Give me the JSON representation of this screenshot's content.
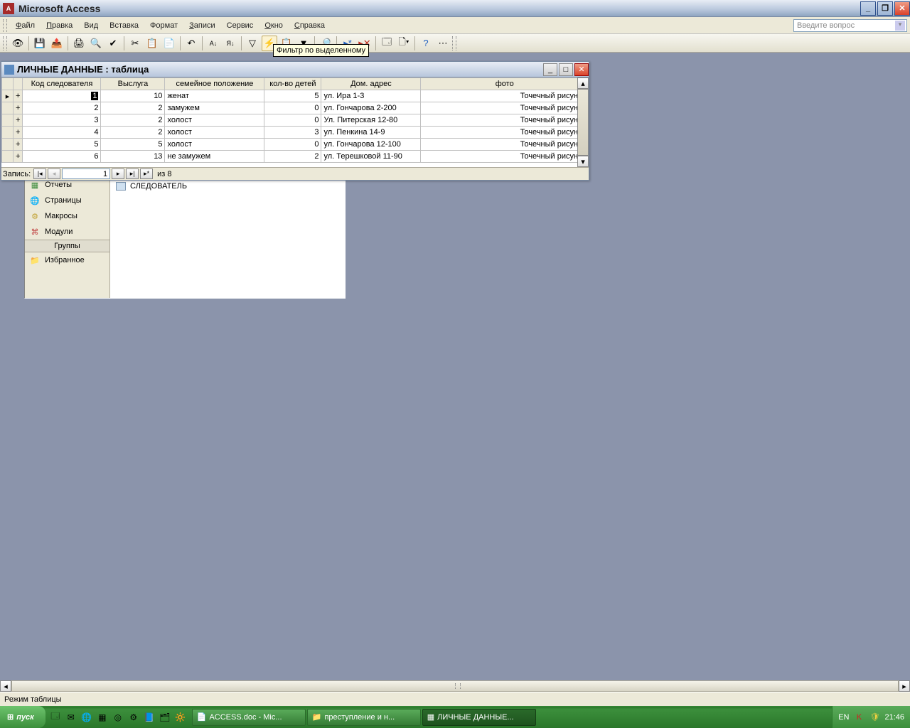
{
  "app": {
    "title": "Microsoft Access"
  },
  "menu": {
    "file": "Файл",
    "edit": "Правка",
    "view": "Вид",
    "insert": "Вставка",
    "format": "Формат",
    "records": "Записи",
    "service": "Сервис",
    "window": "Окно",
    "help": "Справка",
    "ask_placeholder": "Введите вопрос"
  },
  "tooltip": "Фильтр по выделенному",
  "sheet": {
    "title": "ЛИЧНЫЕ ДАННЫЕ : таблица",
    "columns": [
      "Код следователя",
      "Выслуга",
      "семейное положение",
      "кол-во детей",
      "Дом. адрес",
      "фото"
    ],
    "rows": [
      {
        "id": "1",
        "vys": "10",
        "fam": "женат",
        "kids": "5",
        "addr": "ул. Ира 1-3",
        "photo": "Точечный рисунок"
      },
      {
        "id": "2",
        "vys": "2",
        "fam": "замужем",
        "kids": "0",
        "addr": "ул. Гончарова 2-200",
        "photo": "Точечный рисунок"
      },
      {
        "id": "3",
        "vys": "2",
        "fam": "холост",
        "kids": "0",
        "addr": "Ул. Питерская 12-80",
        "photo": "Точечный рисунок"
      },
      {
        "id": "4",
        "vys": "2",
        "fam": "холост",
        "kids": "3",
        "addr": "ул. Пенкина 14-9",
        "photo": "Точечный рисунок"
      },
      {
        "id": "5",
        "vys": "5",
        "fam": "холост",
        "kids": "0",
        "addr": "ул. Гончарова 12-100",
        "photo": "Точечный рисунок"
      },
      {
        "id": "6",
        "vys": "13",
        "fam": "не замужем",
        "kids": "2",
        "addr": "ул. Терешковой 11-90",
        "photo": "Точечный рисунок"
      }
    ],
    "nav": {
      "label": "Запись:",
      "current": "1",
      "total": "из  8"
    }
  },
  "navpanel": {
    "items": {
      "reports": "Отчеты",
      "pages": "Страницы",
      "macros": "Макросы",
      "modules": "Модули"
    },
    "groups": "Группы",
    "favorites": "Избранное",
    "list": {
      "sledovatel": "СЛЕДОВАТЕЛЬ"
    }
  },
  "status": "Режим таблицы",
  "taskbar": {
    "start": "пуск",
    "tasks": [
      {
        "label": "ACCESS.doc - Mic..."
      },
      {
        "label": "преступление и н..."
      },
      {
        "label": "ЛИЧНЫЕ ДАННЫЕ..."
      }
    ],
    "lang": "EN",
    "clock": "21:46"
  }
}
